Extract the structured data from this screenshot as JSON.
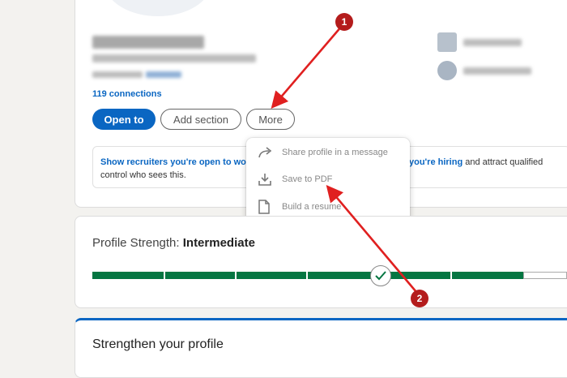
{
  "profile": {
    "connections": "119 connections",
    "buttons": {
      "open_to": "Open to",
      "add_section": "Add section",
      "more": "More"
    }
  },
  "notice": {
    "link1": "Show recruiters you're open to wo",
    "link2": "you're hiring",
    "text_after": " and attract qualified",
    "line2": "control who sees this."
  },
  "more_menu": {
    "items": [
      {
        "label": "Share profile in a message",
        "icon": "share-arrow-icon"
      },
      {
        "label": "Save to PDF",
        "icon": "download-icon"
      },
      {
        "label": "Build a resume",
        "icon": "document-icon"
      }
    ]
  },
  "strength": {
    "label": "Profile Strength: ",
    "level": "Intermediate"
  },
  "strengthen": {
    "title": "Strengthen your profile"
  },
  "annotations": {
    "step1": "1",
    "step2": "2"
  },
  "colors": {
    "brand_blue": "#0a66c2",
    "progress_green": "#057642",
    "annotation_red": "#b41c1c"
  }
}
